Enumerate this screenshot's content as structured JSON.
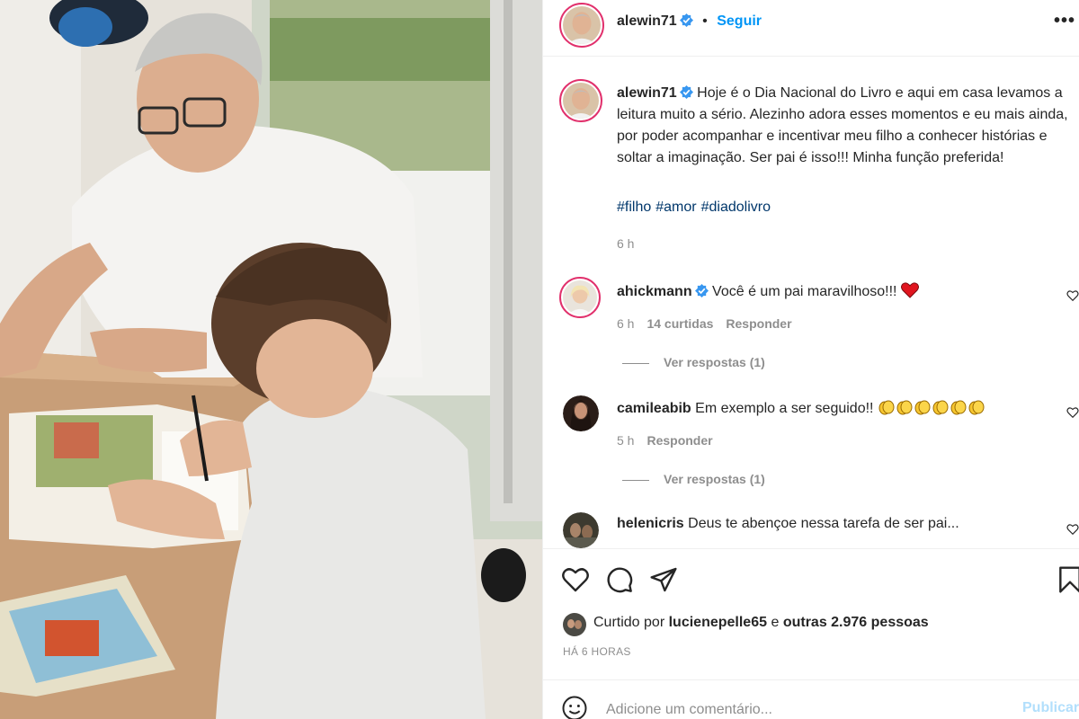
{
  "header": {
    "username": "alewin71",
    "separator": "•",
    "follow_label": "Seguir",
    "more_label": "•••"
  },
  "caption": {
    "username": "alewin71",
    "text": "Hoje é o Dia Nacional do Livro e aqui em casa levamos a leitura muito a sério. Alezinho adora esses momentos e eu mais ainda, por poder acompanhar e incentivar meu filho a conhecer histórias e soltar a imaginação. Ser pai é isso!!! Minha função preferida!",
    "hashtags": [
      "#filho",
      "#amor",
      "#diadolivro"
    ],
    "time": "6 h"
  },
  "comments": [
    {
      "username": "ahickmann",
      "verified": true,
      "text": "Você é um pai maravilhoso!!!",
      "emoji": "heart-emoji",
      "time": "6 h",
      "likes": "14 curtidas",
      "reply_label": "Responder",
      "view_replies": "Ver respostas (1)"
    },
    {
      "username": "camileabib",
      "verified": false,
      "text": "Em exemplo a ser seguido!!",
      "emoji": "clapping-hands-emoji",
      "emoji_count": 6,
      "time": "5 h",
      "reply_label": "Responder",
      "view_replies": "Ver respostas (1)"
    },
    {
      "username": "helenicris",
      "verified": false,
      "text": "Deus te abençoe nessa tarefa de ser pai..."
    }
  ],
  "likes": {
    "prefix": "Curtido por",
    "user": "lucienepelle65",
    "joiner": "e",
    "others": "outras 2.976 pessoas"
  },
  "post_age": "HÁ 6 HORAS",
  "comment_box": {
    "placeholder": "Adicione um comentário...",
    "publish_label": "Publicar"
  },
  "colors": {
    "link_blue": "#0095f6",
    "hashtag_blue": "#00376b",
    "muted_gray": "#8e8e8e",
    "text_dark": "#262626",
    "verified_blue": "#3897f0",
    "publish_disabled": "#b2dffc",
    "story_ring": "#e1306c"
  },
  "icons": [
    "verified-icon",
    "heart-icon",
    "comment-icon",
    "share-icon",
    "bookmark-icon",
    "emoji-icon",
    "more-icon"
  ]
}
